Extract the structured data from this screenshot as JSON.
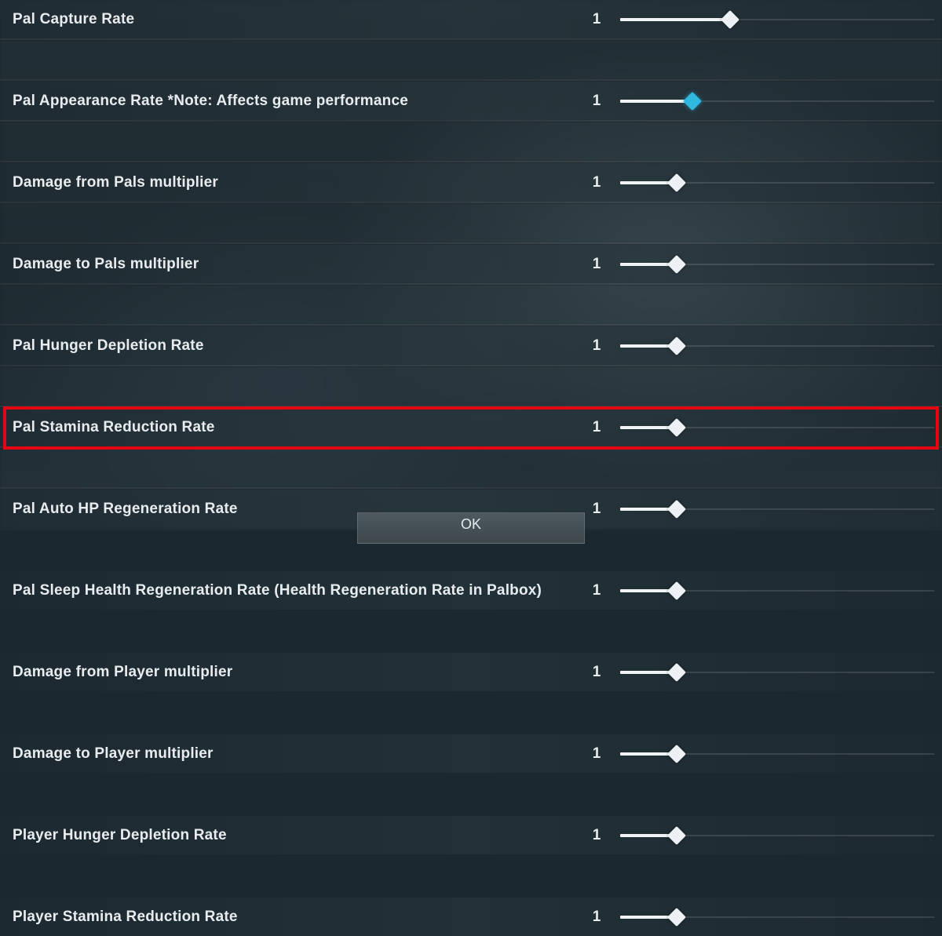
{
  "settings": [
    {
      "label": "Pal Capture Rate",
      "value": "1",
      "fill": 0.35,
      "highlighted": false,
      "accent": false
    },
    {
      "label": "Pal Appearance Rate *Note: Affects game performance",
      "value": "1",
      "fill": 0.23,
      "highlighted": false,
      "accent": true
    },
    {
      "label": "Damage from Pals multiplier",
      "value": "1",
      "fill": 0.18,
      "highlighted": false,
      "accent": false
    },
    {
      "label": "Damage to Pals multiplier",
      "value": "1",
      "fill": 0.18,
      "highlighted": false,
      "accent": false
    },
    {
      "label": "Pal Hunger Depletion Rate",
      "value": "1",
      "fill": 0.18,
      "highlighted": false,
      "accent": false
    },
    {
      "label": "Pal Stamina Reduction Rate",
      "value": "1",
      "fill": 0.18,
      "highlighted": false,
      "accent": false
    },
    {
      "label": "Pal Auto HP Regeneration Rate",
      "value": "1",
      "fill": 0.18,
      "highlighted": false,
      "accent": false
    },
    {
      "label": "Pal Sleep Health Regeneration Rate (Health Regeneration Rate in Palbox)",
      "value": "1",
      "fill": 0.18,
      "highlighted": false,
      "accent": false
    },
    {
      "label": "Damage from Player multiplier",
      "value": "1",
      "fill": 0.18,
      "highlighted": false,
      "accent": false
    },
    {
      "label": "Damage to Player multiplier",
      "value": "1",
      "fill": 0.18,
      "highlighted": false,
      "accent": false
    },
    {
      "label": "Player Hunger Depletion Rate",
      "value": "1",
      "fill": 0.18,
      "highlighted": true,
      "accent": false
    },
    {
      "label": "Player Stamina Reduction Rate",
      "value": "1",
      "fill": 0.18,
      "highlighted": false,
      "accent": false
    }
  ],
  "ok_label": "OK",
  "colors": {
    "highlight": "#e30613",
    "accent_thumb": "#2fb9e0"
  }
}
